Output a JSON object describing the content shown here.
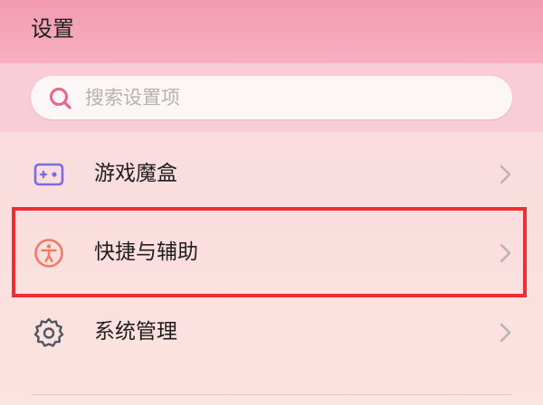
{
  "header": {
    "title": "设置"
  },
  "search": {
    "placeholder": "搜索设置项",
    "icon": "search-icon",
    "accent_color": "#e9638a"
  },
  "menu": {
    "items": [
      {
        "label": "游戏魔盒",
        "icon": "gamepad-icon",
        "icon_color": "#7b6ce0"
      },
      {
        "label": "快捷与辅助",
        "icon": "accessibility-icon",
        "icon_color": "#ef7b61",
        "highlighted": true
      },
      {
        "label": "系统管理",
        "icon": "gear-icon",
        "icon_color": "#4e5660"
      }
    ]
  },
  "colors": {
    "header_bg": "#f39bb0",
    "highlight_border": "#ee2e32",
    "chevron": "#b9b3b4"
  }
}
